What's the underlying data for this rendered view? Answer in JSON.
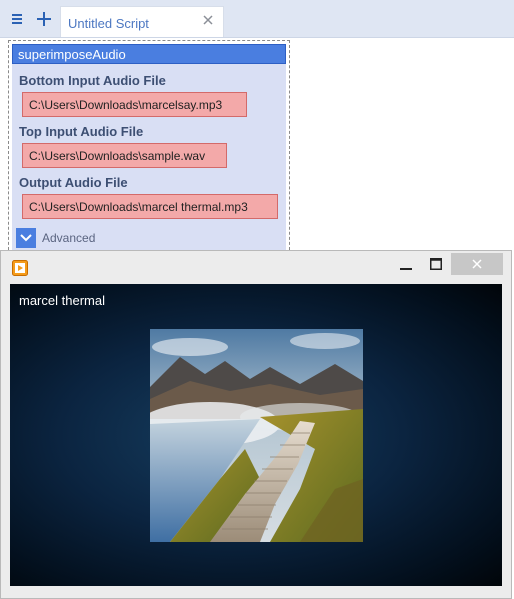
{
  "editor": {
    "toolbar": {
      "menu_icon": "hamburger-menu-icon",
      "add_icon": "plus-icon"
    },
    "tab": {
      "label": "Untitled Script",
      "close_icon": "close-icon"
    },
    "node": {
      "title": "superimposeAudio",
      "fields": [
        {
          "label": "Bottom Input Audio File",
          "value": "C:\\Users\\Downloads\\marcelsay.mp3"
        },
        {
          "label": "Top Input Audio File",
          "value": "C:\\Users\\Downloads\\sample.wav"
        },
        {
          "label": "Output Audio File",
          "value": "C:\\Users\\Downloads\\marcel thermal.mp3"
        }
      ],
      "advanced_label": "Advanced",
      "advanced_icon": "chevron-down-icon"
    },
    "colors": {
      "accent": "#4a7ee0",
      "node_bg": "#d9dff4",
      "field_error_bg": "#f3a9a9"
    }
  },
  "player": {
    "app_icon": "media-player-play-icon",
    "controls": {
      "minimize_icon": "minimize-icon",
      "maximize_icon": "maximize-icon",
      "close_icon": "close-icon"
    },
    "track_title": "marcel thermal",
    "album_art": "album-art-image"
  }
}
